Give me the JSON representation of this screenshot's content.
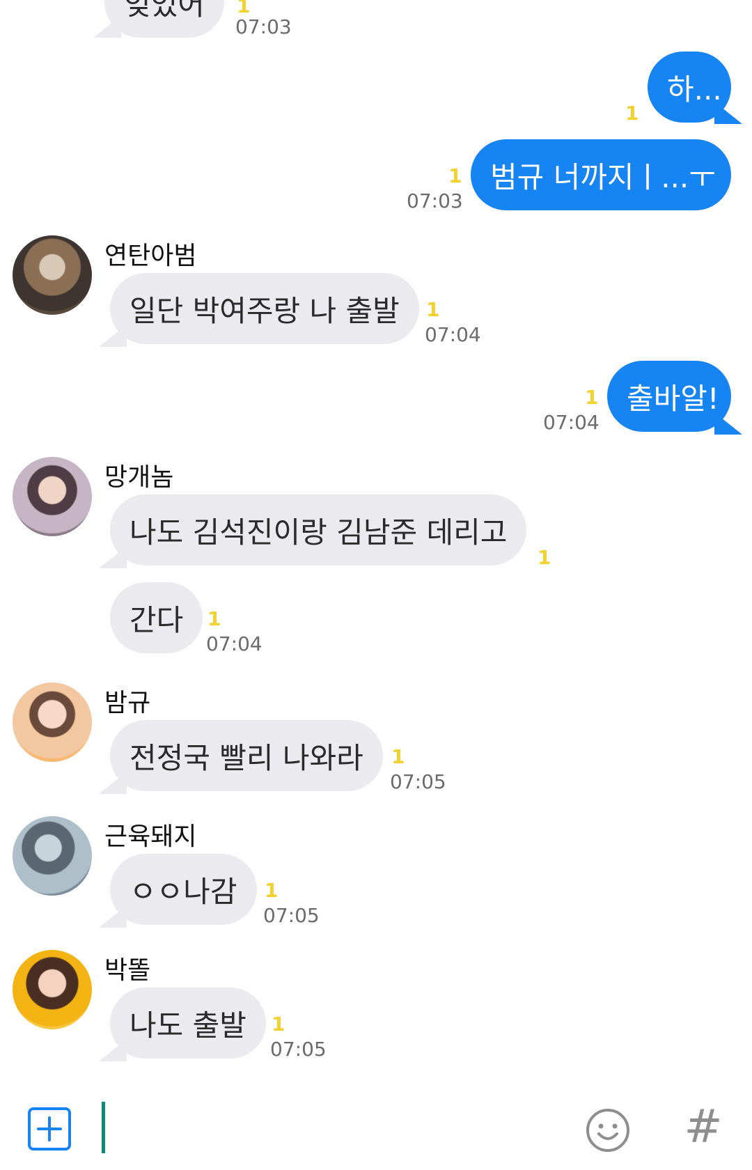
{
  "messages": [
    {
      "sender": "",
      "text": "잊었어",
      "unread": "1",
      "time": "07:03"
    },
    {
      "text": "하...",
      "unread": "1",
      "time": ""
    },
    {
      "text": "범규 너까지ㅣ...ㅜ",
      "unread": "1",
      "time": "07:03"
    },
    {
      "sender": "연탄아범",
      "text": "일단 박여주랑 나 출발",
      "unread": "1",
      "time": "07:04"
    },
    {
      "text": "출바알!",
      "unread": "1",
      "time": "07:04"
    },
    {
      "sender": "망개놈",
      "text": "나도 김석진이랑 김남준 데리고",
      "unread": "1",
      "time": ""
    },
    {
      "text": "간다",
      "unread": "1",
      "time": "07:04"
    },
    {
      "sender": "밤규",
      "text": "전정국 빨리 나와라",
      "unread": "1",
      "time": "07:05"
    },
    {
      "sender": "근육돼지",
      "text": "ㅇㅇ나감",
      "unread": "1",
      "time": "07:05"
    },
    {
      "sender": "박똘",
      "text": "나도 출발",
      "unread": "1",
      "time": "07:05"
    }
  ],
  "input": {
    "placeholder": "",
    "value": ""
  },
  "icons": {
    "add": "plus-square-icon",
    "emoji": "smiley-icon",
    "tag": "hash-icon"
  },
  "colors": {
    "outgoing_bubble": "#1784f3",
    "incoming_bubble": "#ebebef",
    "unread": "#f2d22e",
    "time": "#6b6b6b"
  }
}
